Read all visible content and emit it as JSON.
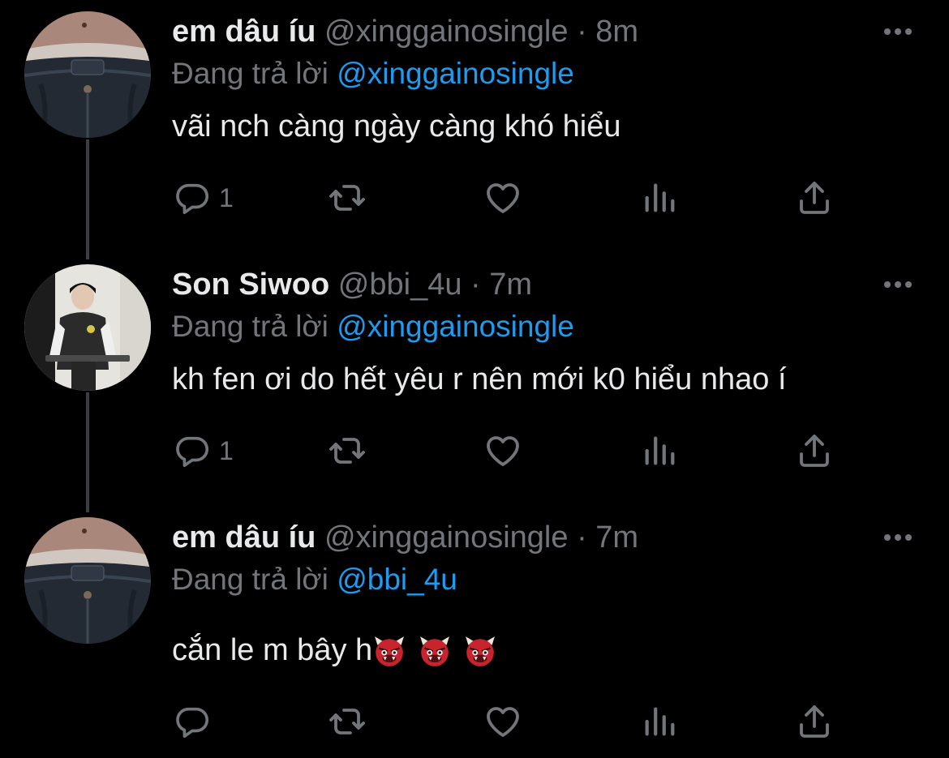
{
  "tweets": [
    {
      "display_name": "em dâu íu",
      "handle": "@xinggainosingle",
      "separator": "·",
      "time": "8m",
      "reply_prefix": "Đang trả lời",
      "reply_to": "@xinggainosingle",
      "text": "vãi nch càng ngày càng khó hiểu",
      "reply_count": "1",
      "avatar": "jeans-waist-photo"
    },
    {
      "display_name": "Son Siwoo",
      "handle": "@bbi_4u",
      "separator": "·",
      "time": "7m",
      "reply_prefix": "Đang trả lời",
      "reply_to": "@xinggainosingle",
      "text": "kh fen ơi do hết yêu r nên mới k0 hiểu nhao í",
      "reply_count": "1",
      "avatar": "person-at-podium-photo"
    },
    {
      "display_name": "em dâu íu",
      "handle": "@xinggainosingle",
      "separator": "·",
      "time": "7m",
      "reply_prefix": "Đang trả lời",
      "reply_to": "@bbi_4u",
      "text": "cắn le m bây h",
      "reply_count": "",
      "emojis": [
        "ogre-emoji",
        "ogre-emoji",
        "ogre-emoji"
      ],
      "avatar": "jeans-waist-photo"
    }
  ],
  "colors": {
    "background": "#000000",
    "text": "#e7e9ea",
    "secondary": "#71767b",
    "link": "#1d9bf0",
    "thread_line": "#3a3f44"
  },
  "icons": [
    "reply-icon",
    "retweet-icon",
    "like-icon",
    "analytics-icon",
    "share-icon",
    "more-icon"
  ]
}
